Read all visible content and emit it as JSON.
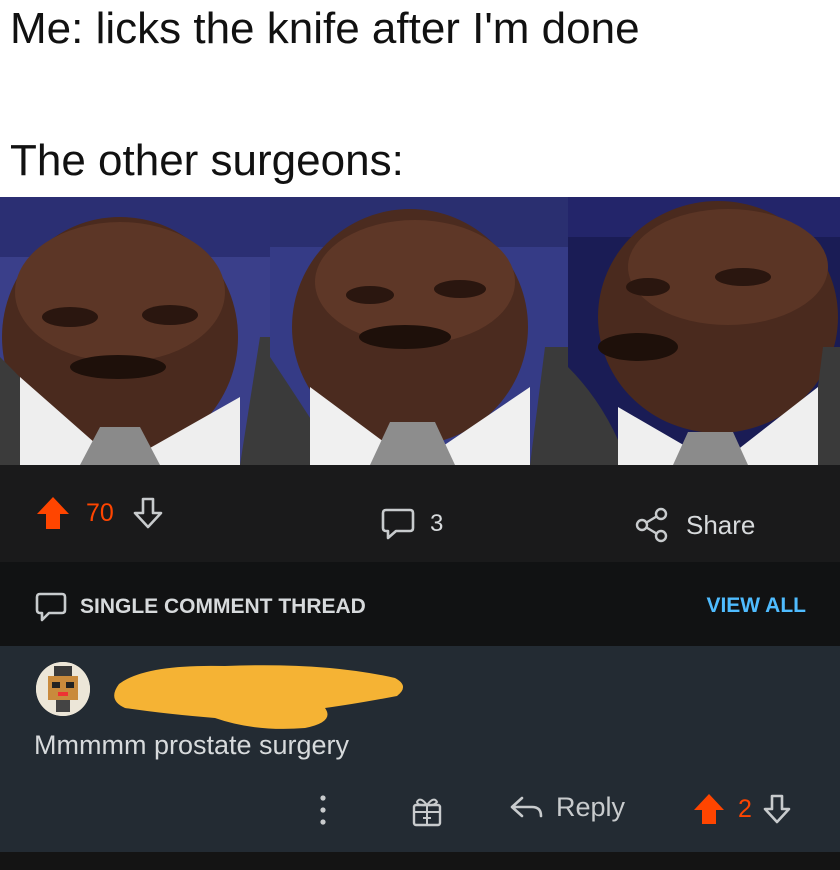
{
  "meme": {
    "caption_line1": "Me: licks the knife after I'm done",
    "caption_line2": "The other surgeons:"
  },
  "post_actions": {
    "upvote_count": "70",
    "comment_count": "3",
    "share_label": "Share"
  },
  "thread_bar": {
    "label": "SINGLE COMMENT THREAD",
    "view_all_label": "VIEW ALL"
  },
  "comment": {
    "text": "Mmmmm prostate surgery",
    "reply_label": "Reply",
    "vote_count": "2"
  },
  "colors": {
    "upvote": "#ff4500",
    "link": "#4fbcff",
    "background": "#1a1a1b",
    "comment_bg": "#232b33",
    "redaction": "#f5b334"
  },
  "icons": [
    "upvote-arrow-icon",
    "downvote-arrow-icon",
    "comment-bubble-icon",
    "share-icon",
    "chat-bubble-icon",
    "more-dots-icon",
    "award-gift-icon",
    "reply-arrow-icon"
  ]
}
